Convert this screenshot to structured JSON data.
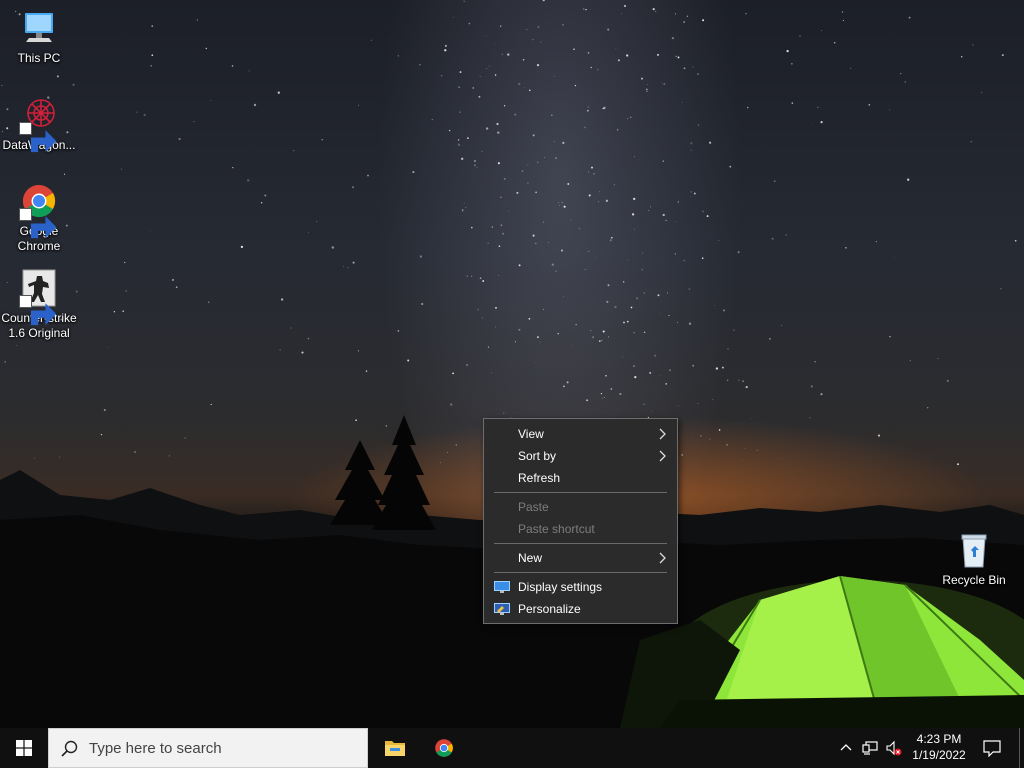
{
  "desktop": {
    "icons": [
      {
        "label": "This PC",
        "icon": "computer-icon"
      },
      {
        "label": "DataWagon...",
        "icon": "datawagon-icon"
      },
      {
        "label": "Google Chrome",
        "icon": "chrome-icon"
      },
      {
        "label": "Counter-strike 1.6 Original",
        "icon": "counter-strike-icon"
      },
      {
        "label": "Recycle Bin",
        "icon": "recycle-bin-icon"
      }
    ]
  },
  "context_menu": {
    "items": [
      {
        "label": "View",
        "submenu": true,
        "enabled": true
      },
      {
        "label": "Sort by",
        "submenu": true,
        "enabled": true
      },
      {
        "label": "Refresh",
        "submenu": false,
        "enabled": true
      },
      {
        "label": "Paste",
        "submenu": false,
        "enabled": false
      },
      {
        "label": "Paste shortcut",
        "submenu": false,
        "enabled": false
      },
      {
        "label": "New",
        "submenu": true,
        "enabled": true
      },
      {
        "label": "Display settings",
        "icon": "display-settings-icon",
        "enabled": true
      },
      {
        "label": "Personalize",
        "icon": "personalize-icon",
        "enabled": true
      }
    ]
  },
  "taskbar": {
    "search": {
      "placeholder": "Type here to search"
    },
    "pinned_apps": [
      "file-explorer-icon",
      "chrome-icon"
    ],
    "tray": {
      "icons": [
        "chevron-up-icon",
        "network-icon",
        "volume-muted-icon"
      ],
      "time": "4:23 PM",
      "date": "1/19/2022"
    }
  },
  "colors": {
    "taskbar_bg": "#101010",
    "menu_bg": "#2b2b2b",
    "menu_disabled_text": "#7d7d7d",
    "tent_green": "#8fe63a"
  }
}
